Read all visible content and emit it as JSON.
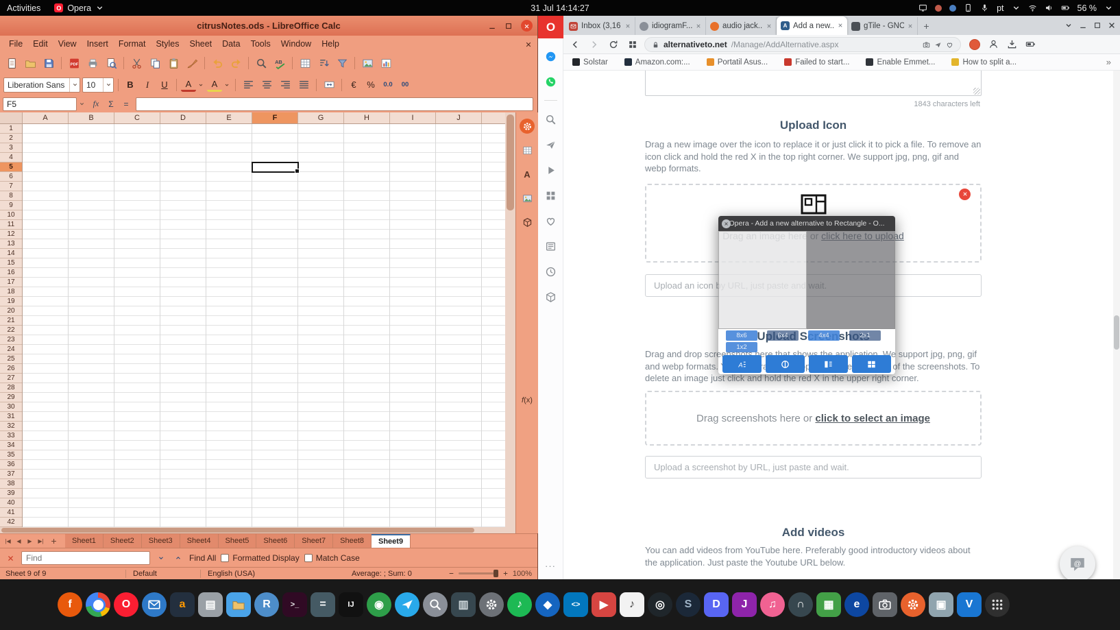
{
  "topbar": {
    "activities_label": "Activities",
    "app_name": "Opera",
    "clock": "31 Jul 14:14:27",
    "keyboard_layout": "pt",
    "battery_percent": "56 %",
    "tray_icons": [
      "screen-cast",
      "camera-red",
      "app-blue",
      "phone",
      "microphone"
    ]
  },
  "calc": {
    "window_title": "citrusNotes.ods - LibreOffice Calc",
    "menu_items": [
      "File",
      "Edit",
      "View",
      "Insert",
      "Format",
      "Styles",
      "Sheet",
      "Data",
      "Tools",
      "Window",
      "Help"
    ],
    "toolbar_icons": [
      "new-document",
      "open",
      "save",
      "|",
      "export-pdf",
      "print",
      "print-preview",
      "|",
      "cut",
      "copy",
      "paste",
      "clone-formatting",
      "|",
      "undo",
      "redo",
      "|",
      "find-replace",
      "spelling",
      "|",
      "insert-row-column",
      "sort",
      "autofilter",
      "|",
      "insert-image",
      "insert-chart"
    ],
    "font_name": "Liberation Sans",
    "font_size": "10",
    "format_glyphs": {
      "bold": "B",
      "italic": "I",
      "underline": "U",
      "font_color": "A",
      "highlight_color": "A",
      "currency": "€",
      "percent": "%",
      "number": "0.0",
      "add_decimal": "00"
    },
    "cell_reference": "F5",
    "formula_buttons": [
      "fx",
      "Σ",
      "="
    ],
    "formula_value": "",
    "column_headers": [
      "A",
      "B",
      "C",
      "D",
      "E",
      "F",
      "G",
      "H",
      "I",
      "J"
    ],
    "selected_column": "F",
    "row_count": 42,
    "selected_row": 5,
    "sheet_nav": [
      "|◀",
      "◀",
      "▶",
      "▶|"
    ],
    "sheet_tabs": [
      "Sheet1",
      "Sheet2",
      "Sheet3",
      "Sheet4",
      "Sheet5",
      "Sheet6",
      "Sheet7",
      "Sheet8",
      "Sheet9"
    ],
    "active_sheet": "Sheet9",
    "sidebar_icons": [
      "settings",
      "properties",
      "styles",
      "gallery",
      "navigator",
      "functions"
    ],
    "findbar": {
      "search_placeholder": "Find",
      "find_all_label": "Find All",
      "formatted_display_label": "Formatted Display",
      "match_case_label": "Match Case"
    },
    "statusbar": {
      "sheet_info": "Sheet 9 of 9",
      "page_style": "Default",
      "language": "English (USA)",
      "stats": "Average: ; Sum: 0",
      "zoom_level": "100%"
    }
  },
  "opera": {
    "tabs": [
      {
        "title": "Inbox (3,16",
        "favicon_color": "#c14438",
        "favicon_glyph": "envelope",
        "active": false
      },
      {
        "title": "idiogramF...",
        "favicon_color": "#8a8f98",
        "favicon_glyph": "circle",
        "active": false
      },
      {
        "title": "audio jack...",
        "favicon_color": "#e8702a",
        "favicon_glyph": "circle",
        "active": false
      },
      {
        "title": "Add a new...",
        "favicon_color": "#2f5d8a",
        "favicon_glyph": "A",
        "active": true
      },
      {
        "title": "gTile - GNO...",
        "favicon_color": "#4a4f55",
        "favicon_glyph": "square",
        "active": false
      }
    ],
    "address": {
      "domain": "alternativeto.net",
      "path": "/Manage/AddAlternative.aspx"
    },
    "bookmarks": [
      {
        "label": "Solstar",
        "color": "#23262b"
      },
      {
        "label": "Amazon.com:...",
        "color": "#232f3e"
      },
      {
        "label": "Portatil Asus...",
        "color": "#e8902b"
      },
      {
        "label": "Failed to start...",
        "color": "#c9392e"
      },
      {
        "label": "Enable Emmet...",
        "color": "#30343a"
      },
      {
        "label": "How to split a...",
        "color": "#e3b52c"
      }
    ],
    "bookmarks_overflow": "»",
    "sidebar_icons": [
      "messenger",
      "whatsapp",
      "|",
      "search",
      "my-flow",
      "player",
      "speed-dial",
      "bookmarks",
      "news",
      "history",
      "extensions"
    ],
    "sidebar_more": "···",
    "page": {
      "chars_left": "1843 characters left",
      "upload_icon_heading": "Upload Icon",
      "upload_icon_text": "Drag a new image over the icon to replace it or just click it to pick a file. To remove an icon click and hold the red X in the top right corner. We support jpg, png, gif and webp formats.",
      "icon_drop_prefix": "Drag an image here or",
      "icon_drop_link": "click here to upload",
      "icon_url_placeholder": "Upload an icon by URL, just paste and wait.",
      "upload_screenshots_heading": "Upload Screenshots",
      "upload_screenshots_text": "Drag and drop screenshots here that shows the application. We support jpg, png, gif and webp formats. You can drag and drop to change the order of the screenshots. To delete an image just click and hold the red X in the upper right corner.",
      "screenshot_drop_prefix": "Drag screenshots here or",
      "screenshot_drop_link": "click to select an image",
      "screenshot_url_placeholder": "Upload a screenshot by URL, just paste and wait.",
      "add_videos_heading": "Add videos",
      "add_videos_text": "You can add videos from YouTube here. Preferably good introductory videos about the application. Just paste the Youtube URL below."
    }
  },
  "gtile": {
    "window_title": "Opera - Add a new alternative to Rectangle - O...",
    "grid_sizes": [
      "8x6",
      "6x4",
      "4x4",
      "2x1"
    ],
    "grid_sizes_row2": [
      "1x2"
    ],
    "selected_sizes": [
      "8x6",
      "4x4",
      "1x2"
    ],
    "action_icons": [
      "autotile",
      "resize",
      "layout-left",
      "layout-grid"
    ]
  },
  "dock": {
    "icons": [
      {
        "name": "firefox",
        "glyph": "f",
        "bg": "#e8590c",
        "fg": "#ffffff",
        "shape": "circle"
      },
      {
        "name": "chrome",
        "glyph": "",
        "bg": "chrome",
        "fg": "#ffffff",
        "shape": "circle"
      },
      {
        "name": "opera",
        "glyph": "O",
        "bg": "#fa1e32",
        "fg": "#ffffff",
        "shape": "circle"
      },
      {
        "name": "thunderbird",
        "glyph": "i:envelope",
        "bg": "#2e79c7",
        "fg": "#ffffff",
        "shape": "circle"
      },
      {
        "name": "amazon",
        "glyph": "a",
        "bg": "#232f3e",
        "fg": "#ff9900",
        "shape": "square"
      },
      {
        "name": "text-editor",
        "glyph": "▤",
        "bg": "#9aa0a6",
        "fg": "#ffffff",
        "shape": "square"
      },
      {
        "name": "files",
        "glyph": "i:folder",
        "bg": "#4aa3e8",
        "fg": "#ffffff",
        "shape": "square"
      },
      {
        "name": "rstudio",
        "glyph": "R",
        "bg": "#4d8dc9",
        "fg": "#ffffff",
        "shape": "circle"
      },
      {
        "name": "terminal",
        "glyph": ">_",
        "bg": "#300a24",
        "fg": "#e8e8e8",
        "shape": "square"
      },
      {
        "name": "calculator",
        "glyph": "=",
        "bg": "#455a64",
        "fg": "#ffffff",
        "shape": "square"
      },
      {
        "name": "intellij",
        "glyph": "IJ",
        "bg": "#111111",
        "fg": "#ffffff",
        "shape": "square"
      },
      {
        "name": "screenshot-tool",
        "glyph": "◉",
        "bg": "#2e9e49",
        "fg": "#ffffff",
        "shape": "circle"
      },
      {
        "name": "telegram",
        "glyph": "i:plane",
        "bg": "#29a9ea",
        "fg": "#ffffff",
        "shape": "circle"
      },
      {
        "name": "search-tool",
        "glyph": "i:search",
        "bg": "#8a8f98",
        "fg": "#ffffff",
        "shape": "circle"
      },
      {
        "name": "remote-desktop",
        "glyph": "▥",
        "bg": "#37474f",
        "fg": "#cfd8dc",
        "shape": "square"
      },
      {
        "name": "tweaks",
        "glyph": "i:gear",
        "bg": "#6d7177",
        "fg": "#ffffff",
        "shape": "circle"
      },
      {
        "name": "spotify",
        "glyph": "♪",
        "bg": "#1db954",
        "fg": "#ffffff",
        "shape": "circle"
      },
      {
        "name": "web-browser",
        "glyph": "◆",
        "bg": "#1565c0",
        "fg": "#ffffff",
        "shape": "circle"
      },
      {
        "name": "vscode",
        "glyph": "<>",
        "bg": "#0277bd",
        "fg": "#ffffff",
        "shape": "square"
      },
      {
        "name": "video-player",
        "glyph": "▶",
        "bg": "#d64541",
        "fg": "#ffffff",
        "shape": "square"
      },
      {
        "name": "music-player",
        "glyph": "♪",
        "bg": "#f2f2f2",
        "fg": "#444444",
        "shape": "square"
      },
      {
        "name": "obs-studio",
        "glyph": "◎",
        "bg": "#1f262b",
        "fg": "#ffffff",
        "shape": "circle"
      },
      {
        "name": "steam",
        "glyph": "S",
        "bg": "#1b2838",
        "fg": "#9fb4c7",
        "shape": "circle"
      },
      {
        "name": "discord",
        "glyph": "D",
        "bg": "#5865f2",
        "fg": "#ffffff",
        "shape": "square"
      },
      {
        "name": "media-server",
        "glyph": "J",
        "bg": "#8e24aa",
        "fg": "#ffffff",
        "shape": "square"
      },
      {
        "name": "music-store",
        "glyph": "♫",
        "bg": "#f06292",
        "fg": "#ffffff",
        "shape": "circle"
      },
      {
        "name": "audio-app",
        "glyph": "∩",
        "bg": "#37474f",
        "fg": "#ffffff",
        "shape": "circle"
      },
      {
        "name": "libreoffice-calc",
        "glyph": "▦",
        "bg": "#43a047",
        "fg": "#ffffff",
        "shape": "square"
      },
      {
        "name": "edge",
        "glyph": "e",
        "bg": "#0d47a1",
        "fg": "#ffffff",
        "shape": "circle"
      },
      {
        "name": "image-viewer",
        "glyph": "i:camera",
        "bg": "#5f6368",
        "fg": "#ffffff",
        "shape": "square"
      },
      {
        "name": "settings",
        "glyph": "i:gear",
        "bg": "#e8622d",
        "fg": "#ffffff",
        "shape": "circle"
      },
      {
        "name": "gnome-boxes",
        "glyph": "▣",
        "bg": "#90a4ae",
        "fg": "#ffffff",
        "shape": "square"
      },
      {
        "name": "virtualbox",
        "glyph": "V",
        "bg": "#1976d2",
        "fg": "#ffffff",
        "shape": "square"
      },
      {
        "name": "show-apps",
        "glyph": "i:grid9",
        "bg": "#2f2f2f",
        "fg": "#dcdcdc",
        "shape": "circle"
      }
    ]
  }
}
